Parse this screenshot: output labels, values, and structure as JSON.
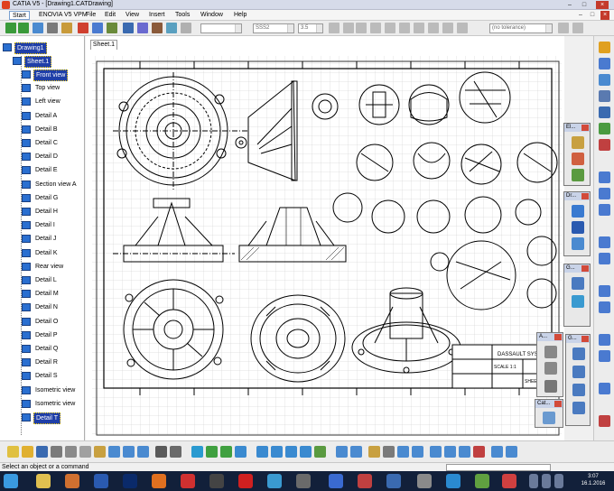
{
  "window": {
    "title": "CATIA V5 - [Drawing1.CATDrawing]",
    "min": "–",
    "max": "□",
    "close": "×"
  },
  "menu": {
    "items": [
      "Start",
      "ENOVIA V5 VPM",
      "File",
      "Edit",
      "View",
      "Insert",
      "Tools",
      "Window",
      "Help"
    ]
  },
  "toolbar": {
    "style_field": "SSS2",
    "size_field": "3.5",
    "tolerance_field": "(no tolerance)"
  },
  "tree": {
    "root": "Drawing1",
    "sheet": "Sheet.1",
    "items": [
      "Front view",
      "Top view",
      "Left view",
      "Detail A",
      "Detail B",
      "Detail C",
      "Detail D",
      "Detail E",
      "Section view A",
      "Detail G",
      "Detail H",
      "Detail I",
      "Detail J",
      "Detail K",
      "Rear view",
      "Detail L",
      "Detail M",
      "Detail N",
      "Detail O",
      "Detail P",
      "Detail Q",
      "Detail R",
      "Detail S",
      "Isometric view",
      "Isometric view",
      "Detail T"
    ]
  },
  "sheet_tab": "Sheet.1",
  "panels": {
    "p1": "El...",
    "p2": "Dr...",
    "p3": "G...",
    "p4": "A...",
    "p5": "G...",
    "p6": "Cat..."
  },
  "title_block": {
    "company": "DASSAULT SYSTEMES",
    "scale": "SCALE 1:1",
    "sheet": "SHEET 1/1"
  },
  "status": {
    "message": "Select an object or a command"
  },
  "clock": {
    "time": "3:07",
    "date": "16.1.2016"
  },
  "colors": {
    "tree_selection": "#1f3fa8",
    "taskbar": "#12203a",
    "title_bar": "#d6dbe9"
  }
}
